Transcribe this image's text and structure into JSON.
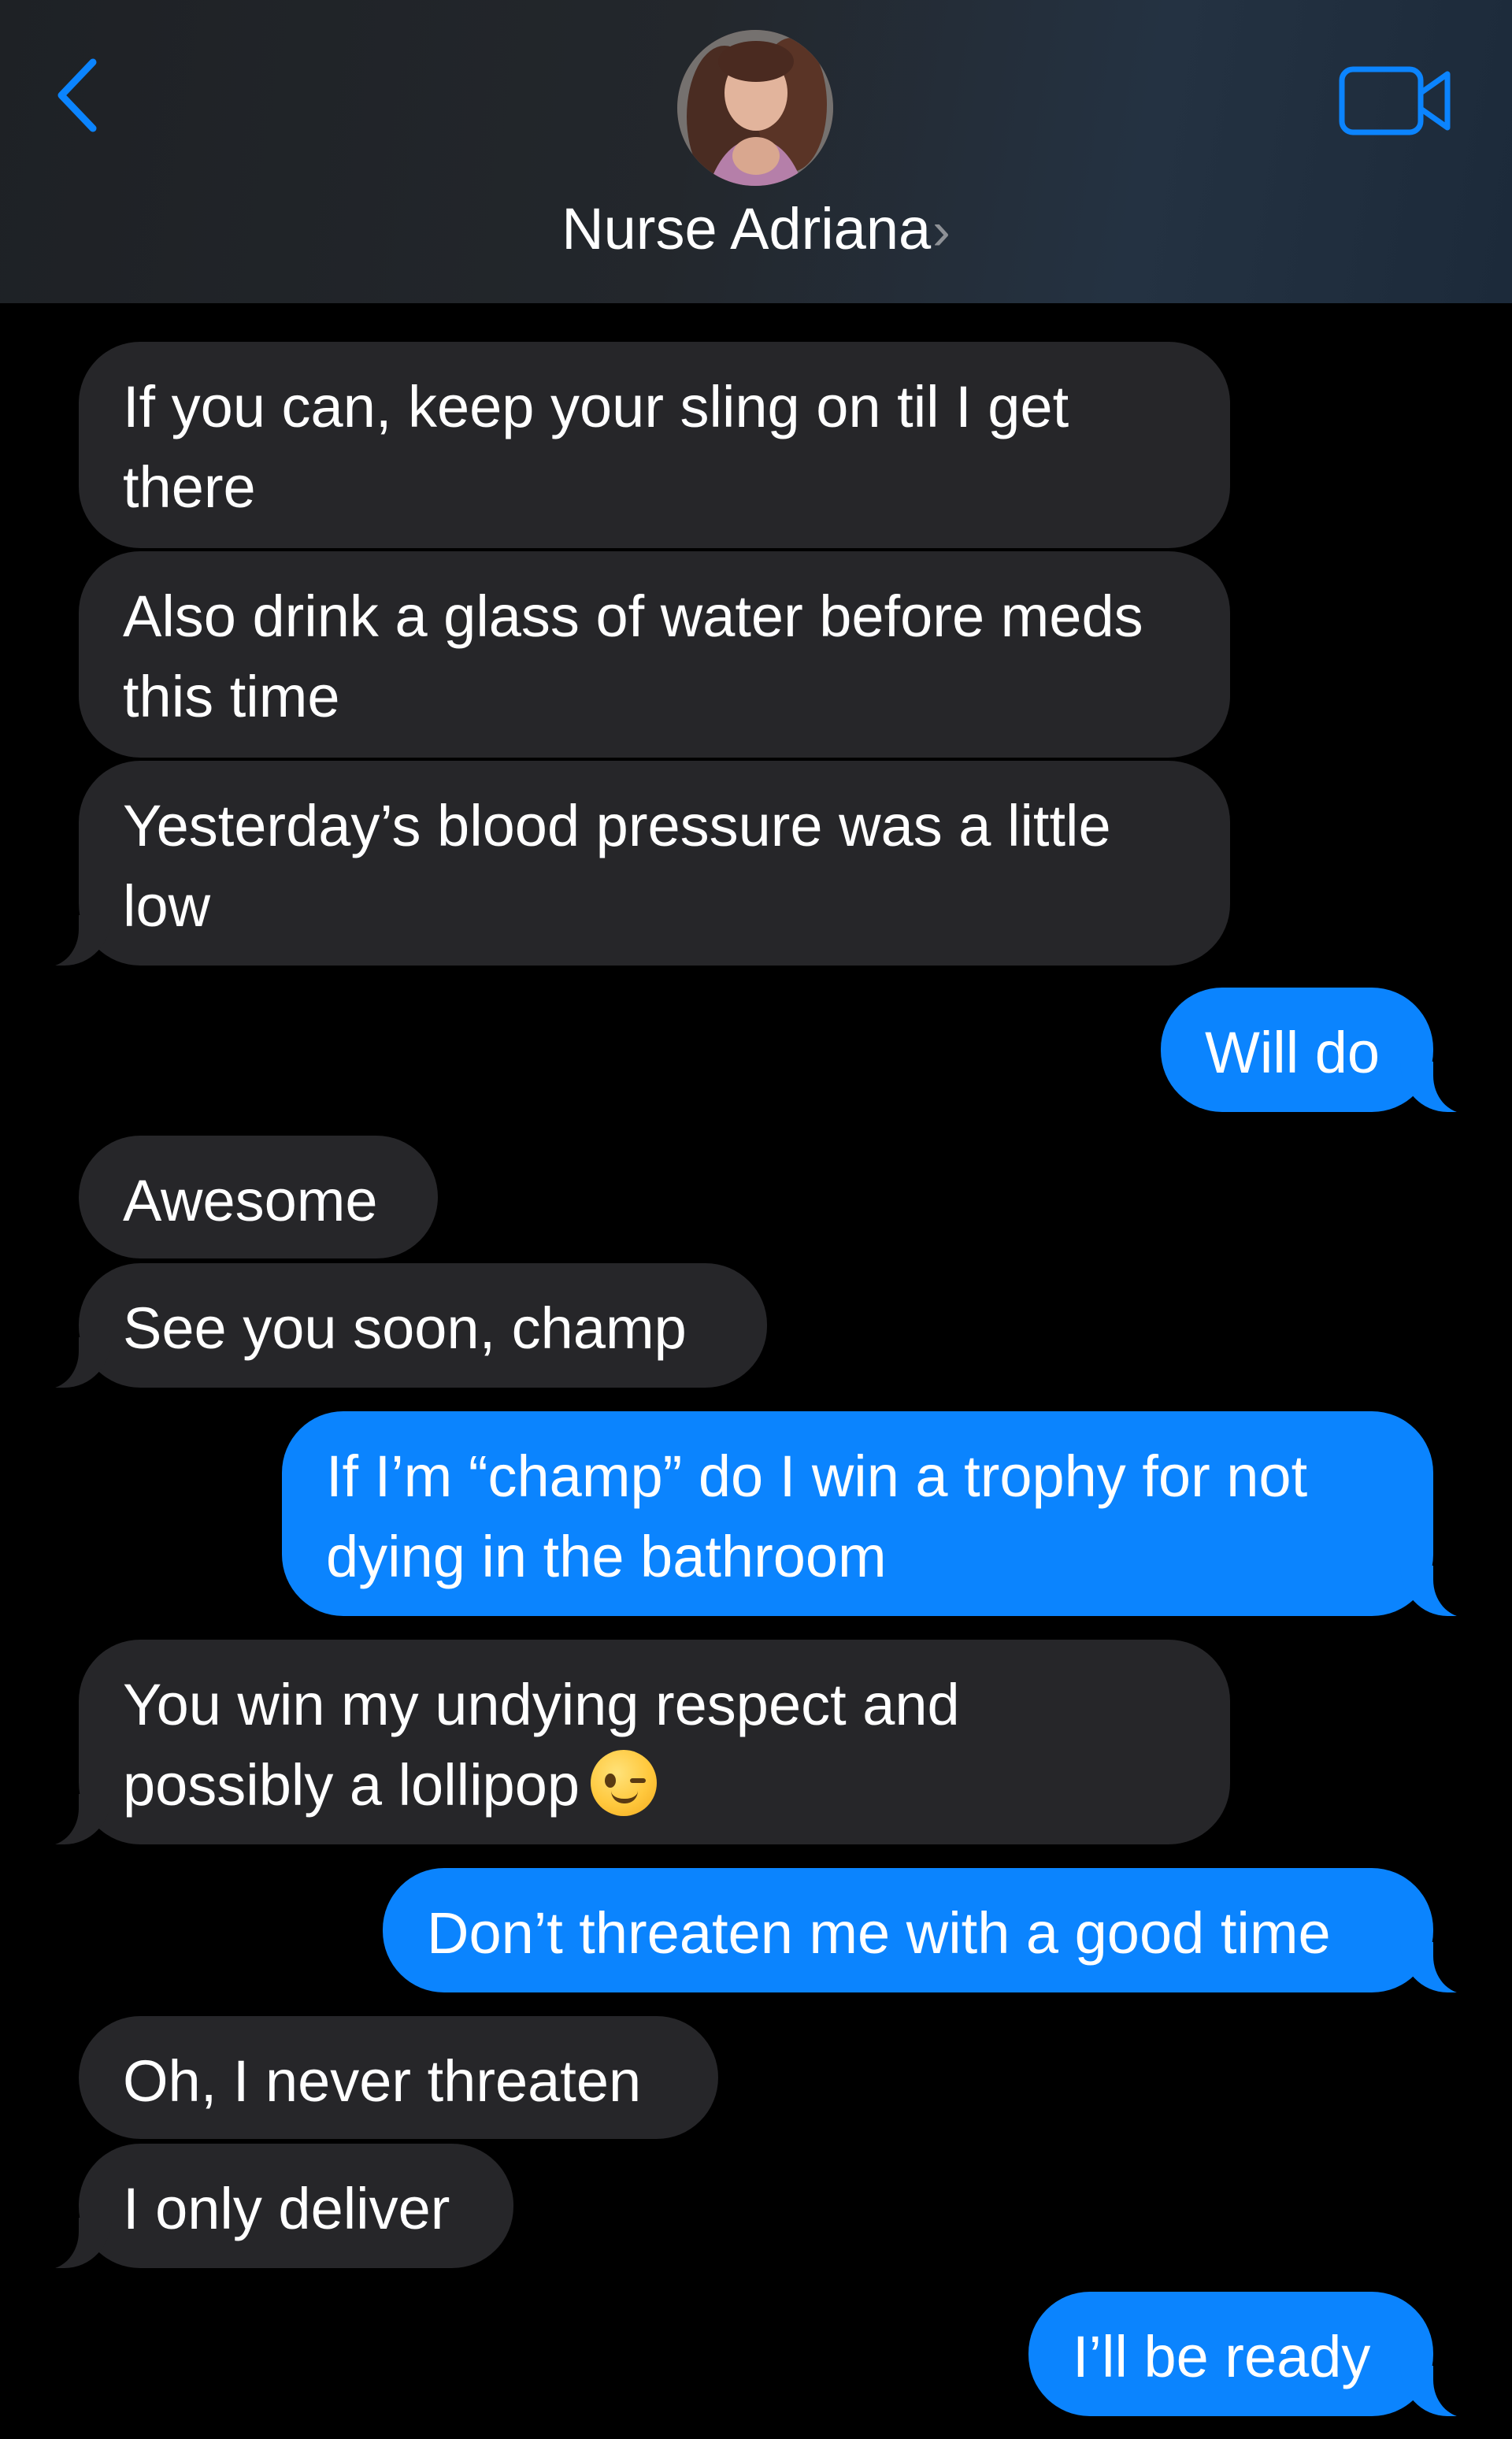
{
  "header": {
    "contact_name": "Nurse Adriana",
    "contact_chevron": "›",
    "back_icon": "chevron-left-icon",
    "video_icon": "video-camera-icon",
    "accent_color": "#0b84fe"
  },
  "messages": [
    {
      "side": "received",
      "text": "If you can, keep your sling on til I get there"
    },
    {
      "side": "received",
      "text": "Also drink a glass of water before meds this time"
    },
    {
      "side": "received",
      "text": "Yesterday’s blood pressure was a little low"
    },
    {
      "side": "sent",
      "text": "Will do"
    },
    {
      "side": "received",
      "text": "Awesome"
    },
    {
      "side": "received",
      "text": "See you soon, champ"
    },
    {
      "side": "sent",
      "text": "If I’m “champ” do I win a trophy for not dying in the bathroom"
    },
    {
      "side": "received",
      "text": "You win my undying respect and possibly a lollipop",
      "emoji": "winking-face-emoji"
    },
    {
      "side": "sent",
      "text": "Don’t threaten me with a good time"
    },
    {
      "side": "received",
      "text": "Oh, I never threaten"
    },
    {
      "side": "received",
      "text": "I only deliver"
    },
    {
      "side": "sent",
      "text": "I’ll be ready"
    }
  ],
  "colors": {
    "sent_bubble": "#0b84fe",
    "received_bubble": "#262629",
    "background": "#000000"
  }
}
